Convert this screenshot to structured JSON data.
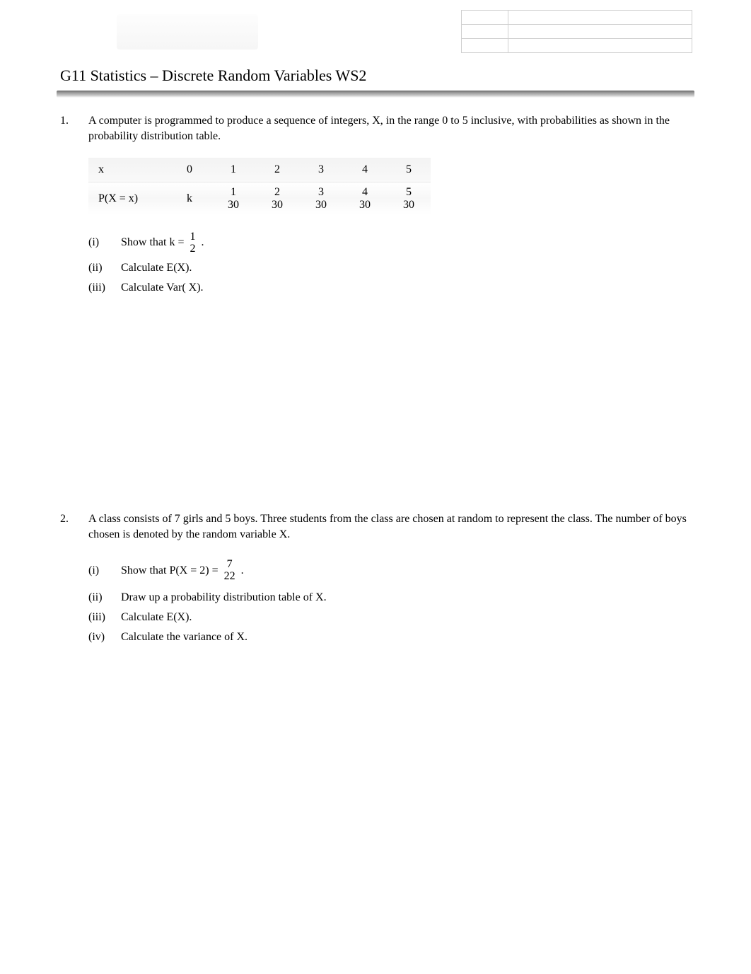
{
  "title": "G11 Statistics – Discrete Random Variables WS2",
  "q1": {
    "num": "1.",
    "intro": "A computer is programmed to produce a sequence of integers, X, in the range 0 to 5 inclusive, with probabilities as shown in the probability distribution table.",
    "table": {
      "row1_label": "x",
      "row2_label": "P(X = x)",
      "cols": [
        "0",
        "1",
        "2",
        "3",
        "4",
        "5"
      ],
      "prob_first": "k",
      "fracs": [
        {
          "num": "1",
          "den": "30"
        },
        {
          "num": "2",
          "den": "30"
        },
        {
          "num": "3",
          "den": "30"
        },
        {
          "num": "4",
          "den": "30"
        },
        {
          "num": "5",
          "den": "30"
        }
      ]
    },
    "parts": {
      "i_num": "(i)",
      "i_pre": "Show that k =",
      "i_frac": {
        "num": "1",
        "den": "2"
      },
      "i_post": ".",
      "ii_num": "(ii)",
      "ii_text": "Calculate E(X).",
      "iii_num": "(iii)",
      "iii_text": "Calculate Var( X)."
    }
  },
  "q2": {
    "num": "2.",
    "intro": "A class consists of 7 girls and 5 boys. Three students from the class are chosen at random to represent the class. The number of boys chosen is denoted by the random variable X.",
    "parts": {
      "i_num": "(i)",
      "i_pre": "Show that P(X = 2) =",
      "i_frac": {
        "num": "7",
        "den": "22"
      },
      "i_post": ".",
      "ii_num": "(ii)",
      "ii_text": "Draw up a probability distribution table of X.",
      "iii_num": "(iii)",
      "iii_text": "Calculate E(X).",
      "iv_num": "(iv)",
      "iv_text": "Calculate the variance of X."
    }
  }
}
